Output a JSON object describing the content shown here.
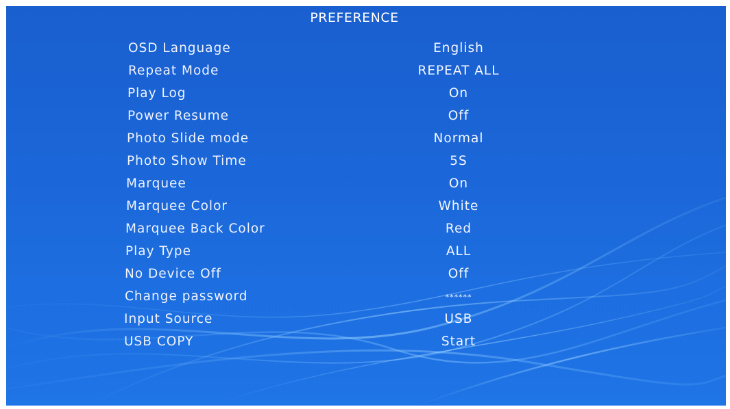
{
  "menu": {
    "title": "PREFERENCE",
    "items": [
      {
        "label": "OSD Language",
        "value": "English"
      },
      {
        "label": "Repeat Mode",
        "value": "REPEAT ALL"
      },
      {
        "label": "Play Log",
        "value": "On"
      },
      {
        "label": "Power Resume",
        "value": "Off"
      },
      {
        "label": "Photo Slide mode",
        "value": "Normal"
      },
      {
        "label": "Photo Show Time",
        "value": "5S"
      },
      {
        "label": "Marquee",
        "value": "On"
      },
      {
        "label": "Marquee Color",
        "value": "White"
      },
      {
        "label": "Marquee Back Color",
        "value": "Red"
      },
      {
        "label": "Play Type",
        "value": "ALL"
      },
      {
        "label": "No Device Off",
        "value": "Off"
      },
      {
        "label": "Change password",
        "value": "******"
      },
      {
        "label": "Input Source",
        "value": "USB"
      },
      {
        "label": "USB COPY",
        "value": "Start"
      }
    ]
  },
  "colors": {
    "background": "#1b66d8",
    "text": "#ffffff"
  }
}
